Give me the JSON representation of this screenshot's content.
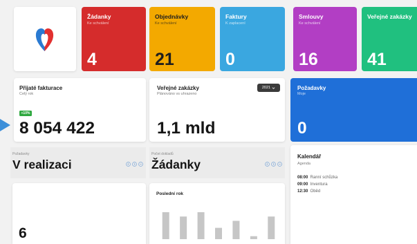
{
  "colors": {
    "page_background": "#f2f2f2",
    "card_background": "#ffffff",
    "requests_card": "#1f6fd8",
    "badge": "#2ea83f",
    "dropdown": "#3b3b3b",
    "header_icons": "#7ea8d8",
    "bars": "#c6c6c6",
    "pointer": "#3d8fd9",
    "logo_blue": "#2a7ad2",
    "logo_red": "#e2302f"
  },
  "logo": {
    "icon": "heart-logo-icon"
  },
  "tiles": [
    {
      "title": "Žádanky",
      "subtitle": "Ke schválení",
      "value": "4",
      "color": "#d52c2c",
      "text_color": "#ffffff"
    },
    {
      "title": "Objednávky",
      "subtitle": "Ke schválení",
      "value": "21",
      "color": "#f3a900",
      "text_color": "#1e1e1e"
    },
    {
      "title": "Faktury",
      "subtitle": "K zaplacení",
      "value": "0",
      "color": "#3aa7e0",
      "text_color": "#ffffff"
    },
    {
      "title": "Smlouvy",
      "subtitle": "Ke schválení",
      "value": "16",
      "color": "#b23ec4",
      "text_color": "#ffffff"
    },
    {
      "title": "Veřejné zakázky",
      "value": "41",
      "color": "#20c07f",
      "text_color": "#ffffff"
    }
  ],
  "invoices": {
    "title": "Přijaté fakturace",
    "subtitle": "Celý rok",
    "badge": "+10%",
    "value": "8 054 422"
  },
  "tenders": {
    "title": "Veřejné zakázky",
    "subtitle": "Plánováno vs uhrazeno",
    "year_select": "2021",
    "value": "1,1 mld"
  },
  "requests": {
    "title": "Požadavky",
    "subtitle": "Moje",
    "value": "0"
  },
  "in_progress": {
    "label": "Požadavky",
    "title": "V realizaci",
    "value": "6",
    "controls": [
      "circle-chevron-left-icon",
      "circle-chevron-right-icon",
      "circle-minus-icon"
    ]
  },
  "documents": {
    "label": "Počet dokladů",
    "title": "Žádanky",
    "chart_title": "Poslední rok",
    "controls": [
      "circle-chevron-left-icon",
      "circle-chevron-right-icon",
      "circle-minus-icon"
    ]
  },
  "calendar": {
    "title": "Kalendář",
    "subtitle": "Agenda",
    "items": [
      {
        "time": "08:00",
        "text": "Ranní schůzka"
      },
      {
        "time": "09:00",
        "text": "Inventura"
      },
      {
        "time": "12:30",
        "text": "Oběd"
      }
    ]
  },
  "chart_data": {
    "type": "bar",
    "title": "Poslední rok",
    "values": [
      100,
      84,
      100,
      42,
      68,
      11,
      84
    ]
  }
}
